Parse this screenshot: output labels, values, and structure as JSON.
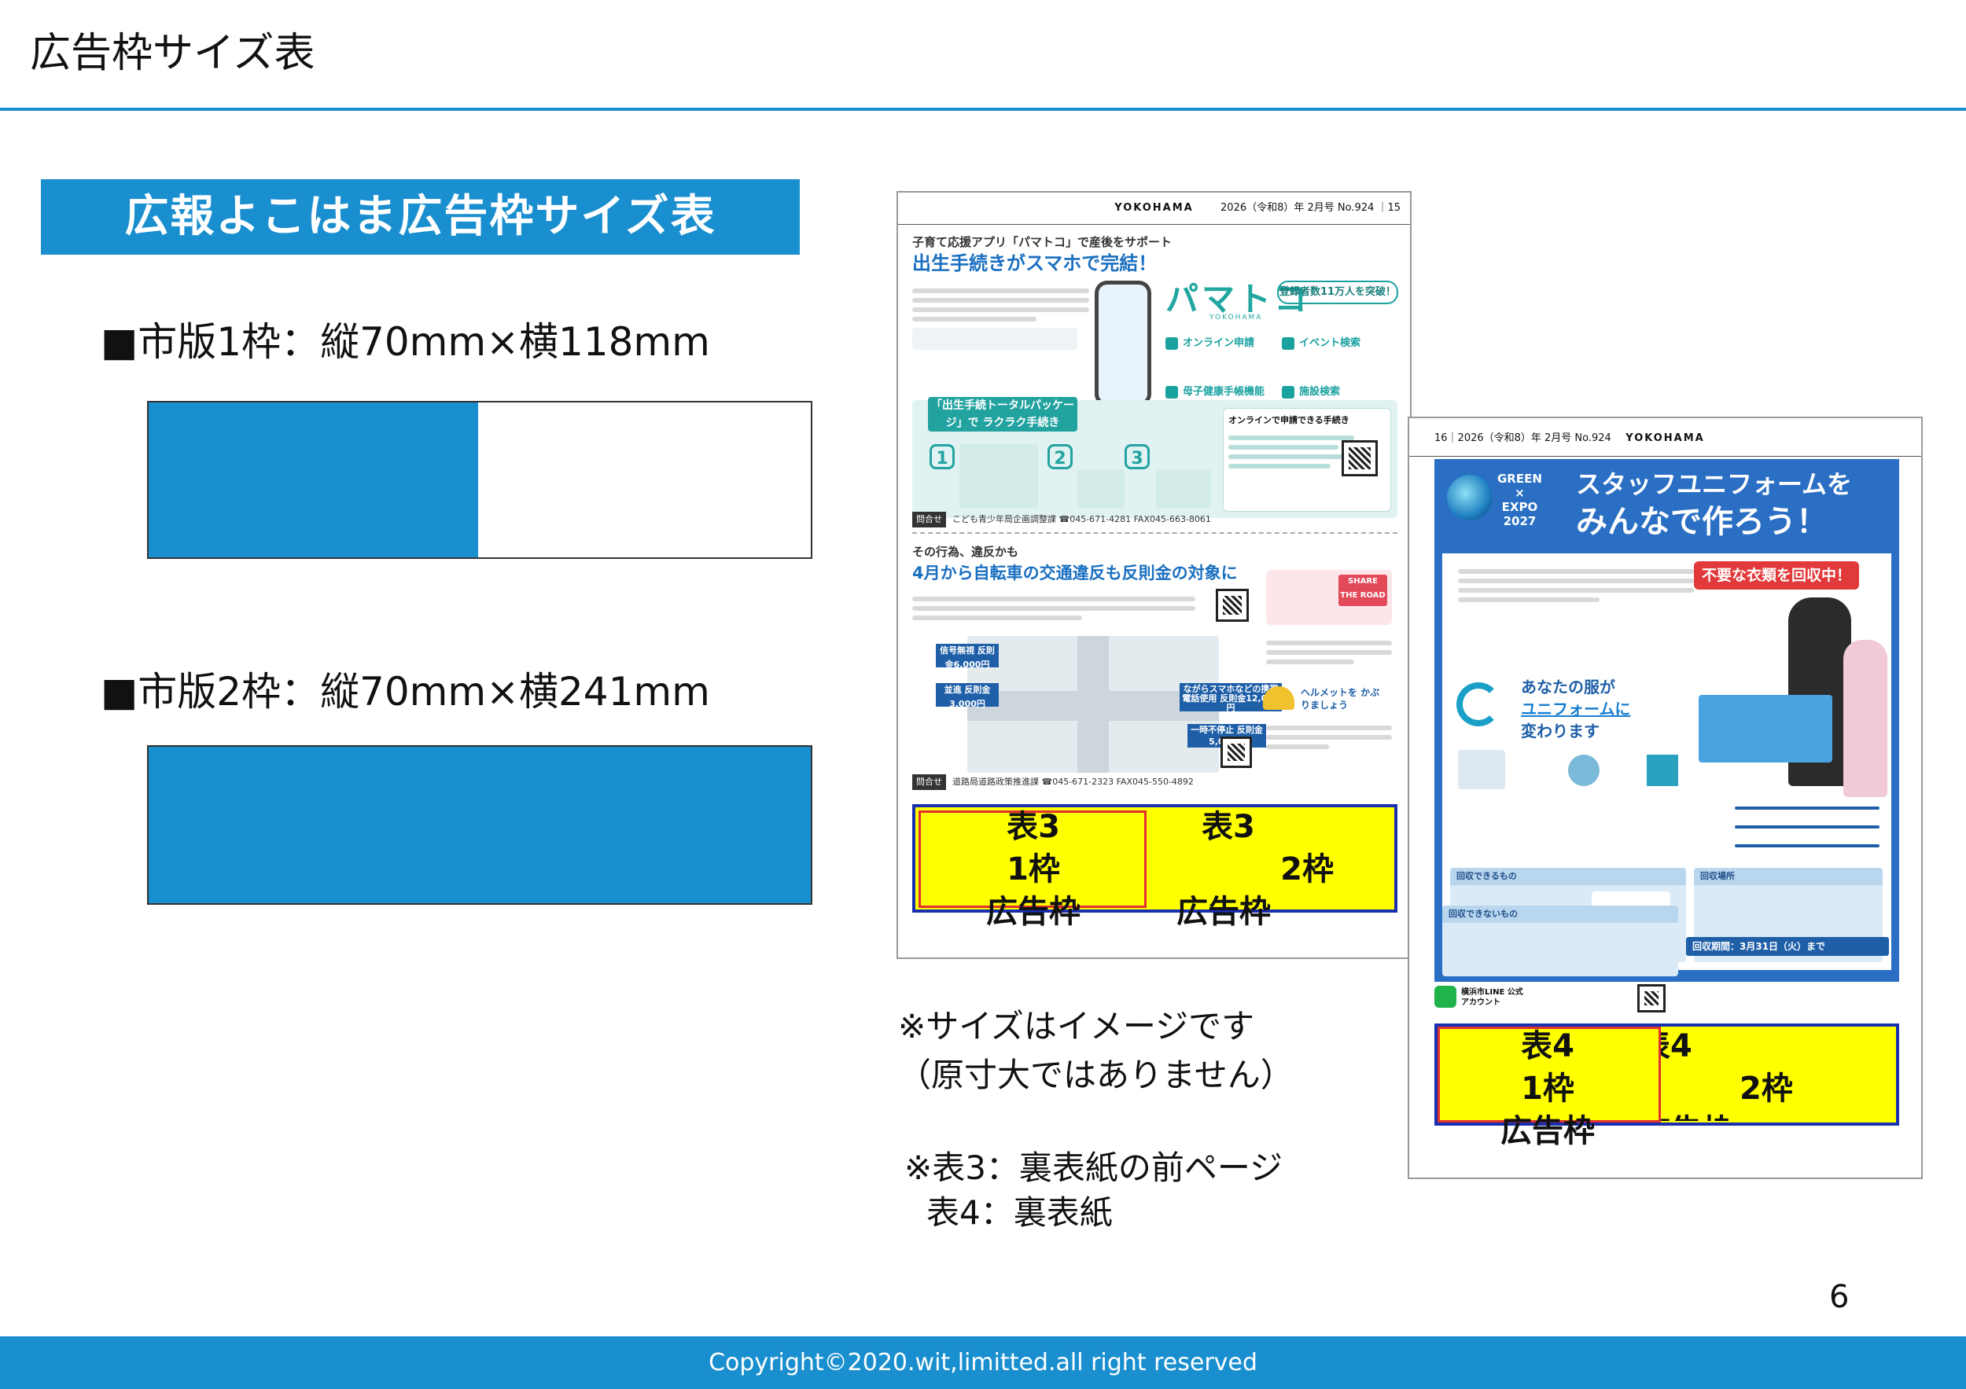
{
  "header": {
    "title": "広告枠サイズ表"
  },
  "section": {
    "title": "広報よこはま広告枠サイズ表"
  },
  "specs": [
    {
      "label": "■市版1枠：縦70mm×横118mm"
    },
    {
      "label": "■市版2枠：縦70mm×横241mm"
    }
  ],
  "notes": {
    "size_note_1": "※サイズはイメージです",
    "size_note_2": "（原寸大ではありません）",
    "h3_note": "※表3：裏表紙の前ページ",
    "h4_note": "表4：裏表紙"
  },
  "mag1": {
    "brand": "YOKOHAMA",
    "issue": "2026（令和8）年 2月号 No.924 ｜15",
    "article1": {
      "kicker": "子育て応援アプリ「パマトコ」で産後をサポート",
      "headline": "出生手続きがスマホで完結！",
      "logo": "パマトコ",
      "logo_sub": "YOKOHAMA",
      "badge": "登録者数11万人を突破！",
      "features": [
        "オンライン申請",
        "イベント検索",
        "母子健康手帳機能",
        "施設検索"
      ],
      "banner": "「出生手続トータルパッケージ」で ラクラク手続き",
      "steps": [
        "1",
        "2",
        "3"
      ],
      "online_title": "オンラインで申請できる手続き",
      "contact_tag": "問合せ",
      "contact": "こども青少年局企画調整課 ☎045-671-4281 FAX045-663-8061"
    },
    "article2": {
      "kicker": "その行為、違反かも",
      "headline": "4月から自転車の交通違反も反則金の対象に",
      "share_road": "SHARE THE ROAD",
      "fines": [
        "信号無視 反則金6,000円",
        "並進 反則金3,000円",
        "ながらスマホなどの携帯電話使用 反則金12,000円",
        "一時不停止 反則金5,000円"
      ],
      "helmet": "ヘルメットを かぶりましょう",
      "contact_tag": "問合せ",
      "contact": "道路局道路政策推進課 ☎045-671-2323 FAX045-550-4892"
    },
    "ad_small": [
      "表3",
      "1枠",
      "広告枠"
    ],
    "ad_wide": [
      "表3",
      "2枠",
      "広告枠"
    ]
  },
  "mag2": {
    "issue": "16｜2026（令和8）年 2月号 No.924",
    "brand": "YOKOHAMA",
    "logo": "GREEN × EXPO 2027",
    "title_l1": "スタッフユニフォームを",
    "title_l2": "みんなで作ろう！",
    "collect": "不要な衣類を回収中！",
    "sub_l1": "あなたの服が",
    "sub_l2": "ユニフォームに",
    "sub_l3": "変わります",
    "section_can": "回収できるもの",
    "section_place": "回収場所",
    "section_cannot": "回収できないもの",
    "deadline": "回収期間：3月31日（火）まで",
    "line_label": "横浜市LINE 公式アカウント",
    "ad_small": [
      "表4",
      "1枠",
      "広告枠"
    ],
    "ad_wide": [
      "表4",
      "2枠",
      "広告枠"
    ]
  },
  "page_number": "6",
  "footer": {
    "copyright": "Copyright©2020.wit,limitted.all right reserved"
  },
  "colors": {
    "accent": "#1a8fcf",
    "ad_yellow": "#ffff00",
    "ad_border": "#1a2fb0",
    "ad_frame": "#e23030"
  }
}
